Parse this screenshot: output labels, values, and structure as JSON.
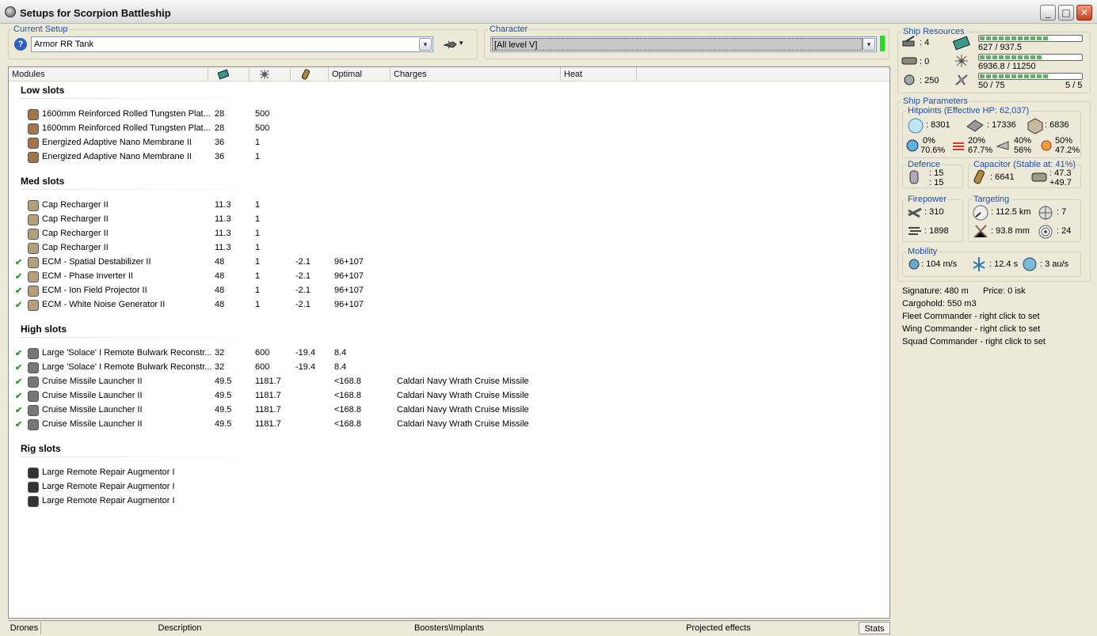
{
  "window": {
    "title": "Setups for Scorpion Battleship",
    "minimize_label": "_",
    "maximize_label": "□",
    "close_label": "✕"
  },
  "current_setup": {
    "legend": "Current Setup",
    "value": "Armor RR Tank",
    "help_label": "?",
    "arrow": "▾",
    "menu_arrow": "▾"
  },
  "character": {
    "legend": "Character",
    "value": "[All level V]",
    "arrow": "▾"
  },
  "columns": {
    "modules": "Modules",
    "optimal": "Optimal",
    "charges": "Charges",
    "heat": "Heat"
  },
  "sections": {
    "low": "Low slots",
    "med": "Med slots",
    "high": "High slots",
    "rig": "Rig slots"
  },
  "low_slots": [
    {
      "name": "1600mm Reinforced Rolled Tungsten Plat...",
      "cpu": "28",
      "pg": "500",
      "cap": "",
      "optimal": "",
      "charge": "",
      "check": ""
    },
    {
      "name": "1600mm Reinforced Rolled Tungsten Plat...",
      "cpu": "28",
      "pg": "500",
      "cap": "",
      "optimal": "",
      "charge": "",
      "check": ""
    },
    {
      "name": "Energized Adaptive Nano Membrane II",
      "cpu": "36",
      "pg": "1",
      "cap": "",
      "optimal": "",
      "charge": "",
      "check": ""
    },
    {
      "name": "Energized Adaptive Nano Membrane II",
      "cpu": "36",
      "pg": "1",
      "cap": "",
      "optimal": "",
      "charge": "",
      "check": ""
    }
  ],
  "med_slots": [
    {
      "name": "Cap Recharger II",
      "cpu": "11.3",
      "pg": "1",
      "cap": "",
      "optimal": "",
      "charge": "",
      "check": ""
    },
    {
      "name": "Cap Recharger II",
      "cpu": "11.3",
      "pg": "1",
      "cap": "",
      "optimal": "",
      "charge": "",
      "check": ""
    },
    {
      "name": "Cap Recharger II",
      "cpu": "11.3",
      "pg": "1",
      "cap": "",
      "optimal": "",
      "charge": "",
      "check": ""
    },
    {
      "name": "Cap Recharger II",
      "cpu": "11.3",
      "pg": "1",
      "cap": "",
      "optimal": "",
      "charge": "",
      "check": ""
    },
    {
      "name": "ECM - Spatial Destabilizer II",
      "cpu": "48",
      "pg": "1",
      "cap": "-2.1",
      "optimal": "96+107",
      "charge": "",
      "check": "✔"
    },
    {
      "name": "ECM - Phase Inverter II",
      "cpu": "48",
      "pg": "1",
      "cap": "-2.1",
      "optimal": "96+107",
      "charge": "",
      "check": "✔"
    },
    {
      "name": "ECM - Ion Field Projector II",
      "cpu": "48",
      "pg": "1",
      "cap": "-2.1",
      "optimal": "96+107",
      "charge": "",
      "check": "✔"
    },
    {
      "name": "ECM - White Noise Generator II",
      "cpu": "48",
      "pg": "1",
      "cap": "-2.1",
      "optimal": "96+107",
      "charge": "",
      "check": "✔"
    }
  ],
  "high_slots": [
    {
      "name": "Large 'Solace' I Remote Bulwark Reconstr...",
      "cpu": "32",
      "pg": "600",
      "cap": "-19.4",
      "optimal": "8.4",
      "charge": "",
      "check": "✔"
    },
    {
      "name": "Large 'Solace' I Remote Bulwark Reconstr...",
      "cpu": "32",
      "pg": "600",
      "cap": "-19.4",
      "optimal": "8.4",
      "charge": "",
      "check": "✔"
    },
    {
      "name": "Cruise Missile Launcher II",
      "cpu": "49.5",
      "pg": "1181.7",
      "cap": "",
      "optimal": "<168.8",
      "charge": "Caldari Navy Wrath Cruise Missile",
      "check": "✔"
    },
    {
      "name": "Cruise Missile Launcher II",
      "cpu": "49.5",
      "pg": "1181.7",
      "cap": "",
      "optimal": "<168.8",
      "charge": "Caldari Navy Wrath Cruise Missile",
      "check": "✔"
    },
    {
      "name": "Cruise Missile Launcher II",
      "cpu": "49.5",
      "pg": "1181.7",
      "cap": "",
      "optimal": "<168.8",
      "charge": "Caldari Navy Wrath Cruise Missile",
      "check": "✔"
    },
    {
      "name": "Cruise Missile Launcher II",
      "cpu": "49.5",
      "pg": "1181.7",
      "cap": "",
      "optimal": "<168.8",
      "charge": "Caldari Navy Wrath Cruise Missile",
      "check": "✔"
    }
  ],
  "rig_slots": [
    {
      "name": "Large Remote Repair Augmentor I",
      "cpu": "",
      "pg": "",
      "cap": "",
      "optimal": "",
      "charge": "",
      "check": ""
    },
    {
      "name": "Large Remote Repair Augmentor I",
      "cpu": "",
      "pg": "",
      "cap": "",
      "optimal": "",
      "charge": "",
      "check": ""
    },
    {
      "name": "Large Remote Repair Augmentor I",
      "cpu": "",
      "pg": "",
      "cap": "",
      "optimal": "",
      "charge": "",
      "check": ""
    }
  ],
  "bottom_tabs": {
    "drones": "Drones",
    "description": "Description",
    "boosters": "Boosters\\Implants",
    "projected": "Projected effects",
    "stats": "Stats"
  },
  "resources": {
    "legend": "Ship Resources",
    "turrets": ": 4",
    "launchers": ": 0",
    "drone_bay": ": 250",
    "cpu": "627 / 937.5",
    "cpu_fraction": 0.67,
    "powergrid": "6936.8 / 11250",
    "powergrid_fraction": 0.62,
    "calibration": "50 / 75",
    "calibration_fraction": 0.67,
    "rigs": "5 / 5"
  },
  "parameters": {
    "legend": "Ship Parameters",
    "hitpoints_legend": "Hitpoints (Effective HP: 62,037)",
    "shield": ": 8301",
    "armor": ": 17336",
    "hull": ": 6836",
    "em": "0%",
    "em2": "70.6%",
    "thermal": "20%",
    "thermal2": "67.7%",
    "kinetic": "40%",
    "kinetic2": "56%",
    "explosive": "50%",
    "explosive2": "47.2%",
    "defence_legend": "Defence",
    "defence1": ": 15",
    "defence2": ": 15",
    "capacitor_legend": "Capacitor (Stable at: 41%)",
    "capacitor": ": 6641",
    "cap_use": ": 47.3",
    "cap_regen": "+49.7",
    "firepower_legend": "Firepower",
    "firepower1": ": 310",
    "firepower2": ": 1898",
    "targeting_legend": "Targeting",
    "range": ": 112.5 km",
    "targets": ": 7",
    "scan_res": ": 93.8 mm",
    "sensor": ": 24",
    "mobility_legend": "Mobility",
    "velocity": ": 104 m/s",
    "align": ": 12.4 s",
    "warp": ": 3 au/s",
    "signature": "Signature: 480 m",
    "price": "Price: 0 isk",
    "cargohold": "Cargohold: 550 m3",
    "fleet": "Fleet Commander - right click to set",
    "wing": "Wing Commander - right click to set",
    "squad": "Squad Commander - right click to set"
  },
  "colors": {
    "legend": "#1c4fa5",
    "check": "#2f9b2f",
    "status_ok": "#22dd22"
  }
}
